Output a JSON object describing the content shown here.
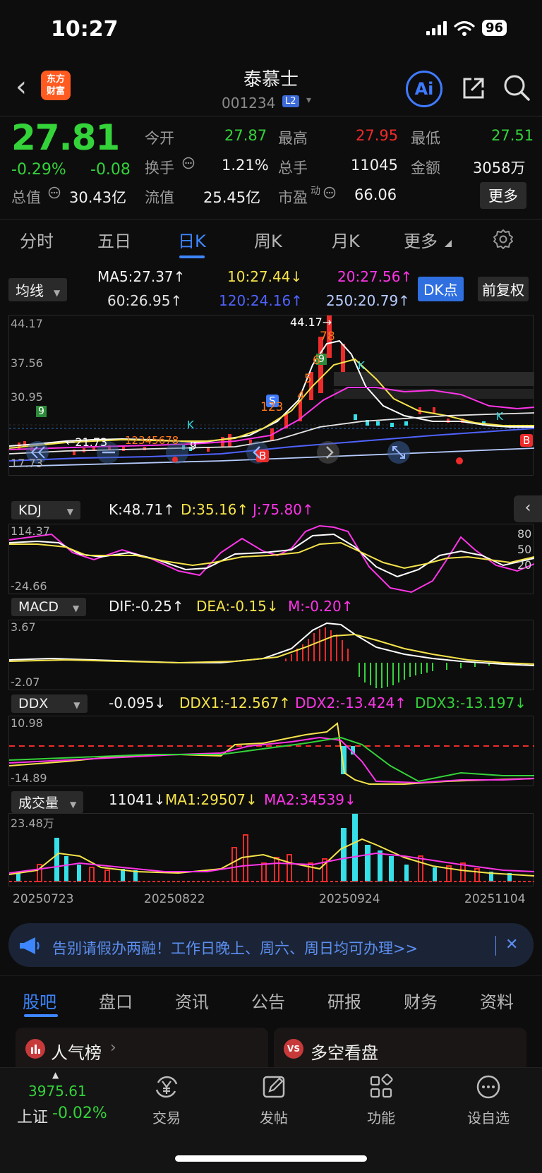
{
  "status": {
    "time": "10:27",
    "battery": "96"
  },
  "header": {
    "logo_line1": "东方",
    "logo_line2": "财富",
    "name": "泰慕士",
    "code": "001234",
    "badge": "L2",
    "ai": "Ai"
  },
  "quote": {
    "price": "27.81",
    "pct": "-0.29%",
    "chg": "-0.08",
    "open_label": "今开",
    "open": "27.87",
    "high_label": "最高",
    "high": "27.95",
    "low_label": "最低",
    "low": "27.51",
    "turnover_label": "换手",
    "turnover": "1.21%",
    "volume_label": "总手",
    "volume": "11045",
    "amount_label": "金额",
    "amount": "3058万",
    "mktcap_label": "总值",
    "mktcap": "30.43亿",
    "float_label": "流值",
    "float": "25.45亿",
    "pe_label": "市盈",
    "pe_sup": "动",
    "pe": "66.06",
    "more": "更多"
  },
  "tabs": [
    "分时",
    "五日",
    "日K",
    "周K",
    "月K",
    "更多"
  ],
  "ma": {
    "selector": "均线",
    "ma5": "MA5:27.37↑",
    "ma10": "10:27.44↓",
    "ma20": "20:27.56↑",
    "ma60": "60:26.95↑",
    "ma120": "120:24.16↑",
    "ma250": "250:20.79↑",
    "dk": "DK点",
    "fq": "前复权"
  },
  "kline": {
    "y_top": "44.17",
    "y_2": "37.56",
    "y_3": "30.95",
    "y_bottom": "17.73",
    "max_label": "44.17→",
    "min_label": "←21.73",
    "tags": {
      "s": "S",
      "b": "B",
      "k": "K",
      "n9": "9",
      "n123": "123",
      "n12345678": "12345678",
      "n4": "4",
      "n5": "5",
      "n6": "6",
      "n78": "78"
    }
  },
  "kdj": {
    "selector": "KDJ",
    "k": "K:48.71↑",
    "d": "D:35.16↑",
    "j": "J:75.80↑",
    "y_top": "114.37",
    "y_bottom": "-24.66",
    "r80": "80",
    "r50": "50",
    "r20": "20"
  },
  "macd": {
    "selector": "MACD",
    "dif": "DIF:-0.25↑",
    "dea": "DEA:-0.15↓",
    "m": "M:-0.20↑",
    "y_top": "3.67",
    "y_bottom": "-2.07"
  },
  "ddx": {
    "selector": "DDX",
    "v": "-0.095↓",
    "d1": "DDX1:-12.567↑",
    "d2": "DDX2:-13.424↑",
    "d3": "DDX3:-13.197↓",
    "y_top": "10.98",
    "y_bottom": "-14.89"
  },
  "vol": {
    "selector": "成交量",
    "v": "11041↓",
    "ma1": "MA1:29507↓",
    "ma2": "MA2:34539↓",
    "y_top": "23.48万"
  },
  "dates": [
    "20250723",
    "20250822",
    "20250924",
    "20251104"
  ],
  "banner": {
    "text": "告别请假办两融！工作日晚上、周六、周日均可办理>>"
  },
  "bottom_tabs": [
    "股吧",
    "盘口",
    "资讯",
    "公告",
    "研报",
    "财务",
    "资料"
  ],
  "cards": {
    "left": "人气榜",
    "right": "多空看盘",
    "vs": "VS"
  },
  "nav": {
    "index_value": "3975.61",
    "index_name": "上证",
    "index_chg": "-0.02%",
    "trade": "交易",
    "post": "发帖",
    "func": "功能",
    "watch": "设自选"
  },
  "colors": {
    "up": "#ee2b2b",
    "down": "#34d33a",
    "accent": "#3d86ff"
  }
}
